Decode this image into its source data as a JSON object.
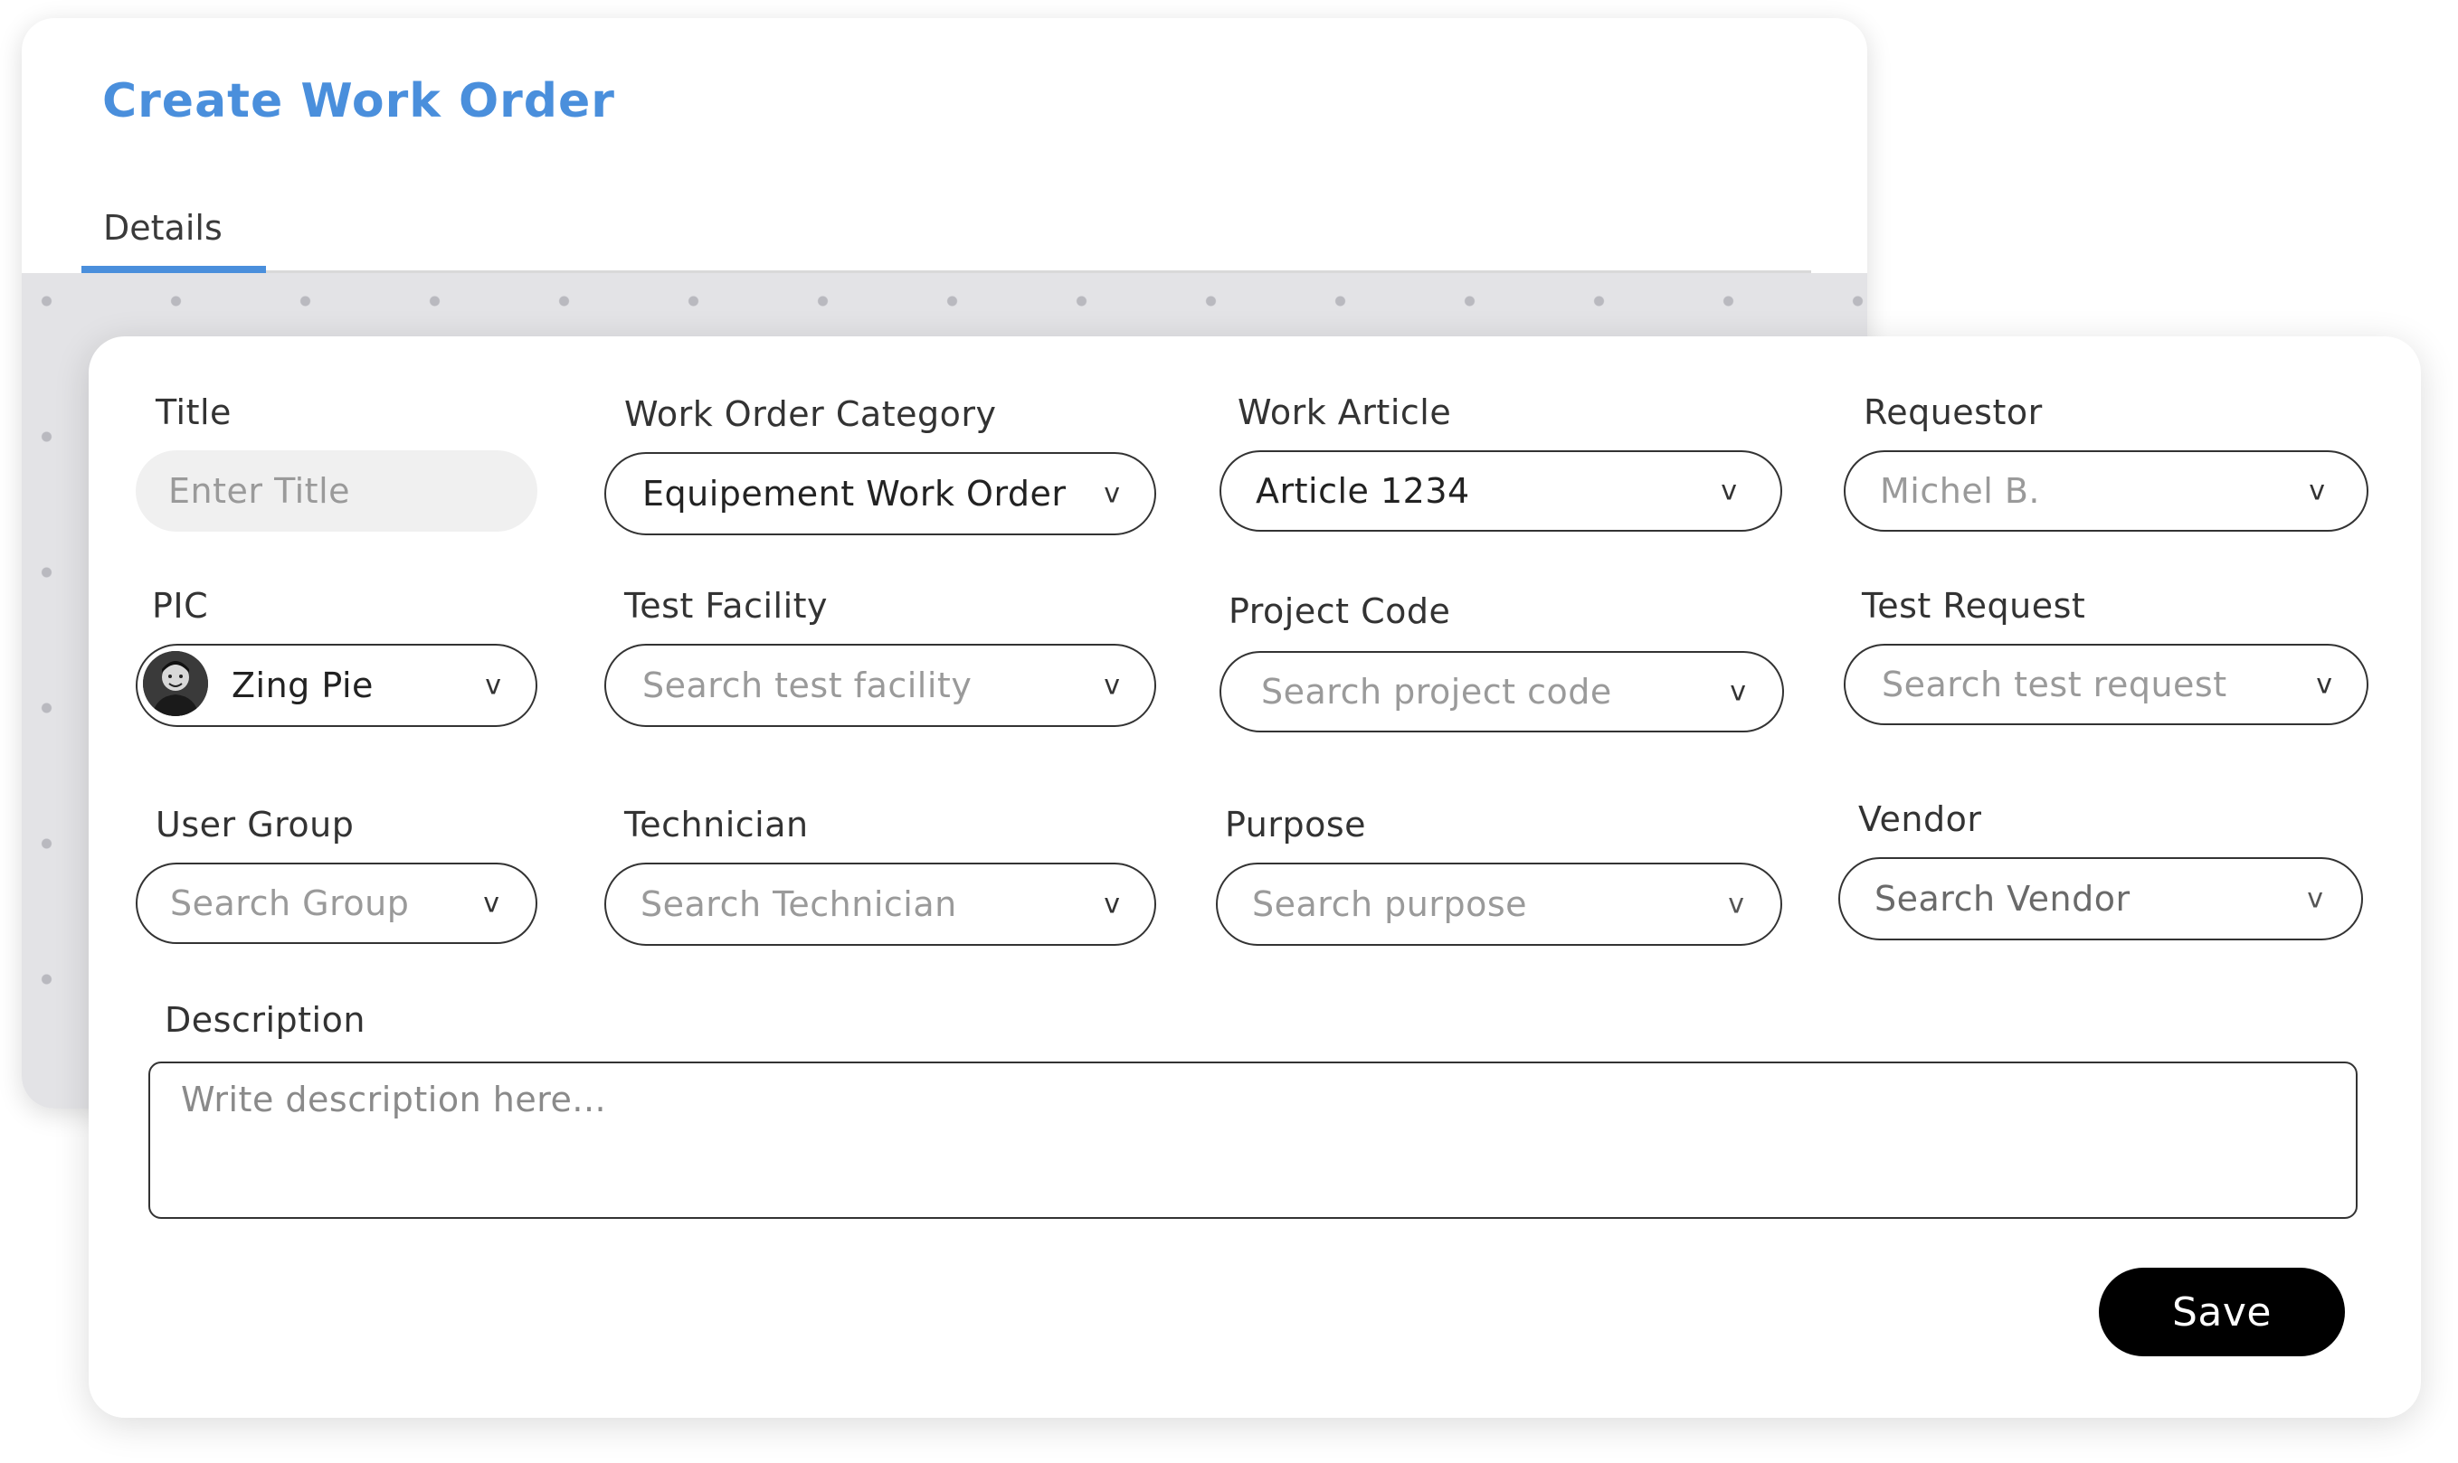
{
  "page": {
    "title": "Create Work Order",
    "tabs": [
      {
        "label": "Details",
        "active": true
      }
    ]
  },
  "form": {
    "title": {
      "label": "Title",
      "placeholder": "Enter Title"
    },
    "work_order_category": {
      "label": "Work Order Category",
      "value": "Equipement Work Order"
    },
    "work_article": {
      "label": "Work Article",
      "value": "Article 1234"
    },
    "requestor": {
      "label": "Requestor",
      "placeholder": "Michel B."
    },
    "pic": {
      "label": "PIC",
      "value": "Zing Pie"
    },
    "test_facility": {
      "label": "Test Facility",
      "placeholder": "Search test facility"
    },
    "project_code": {
      "label": "Project Code",
      "placeholder": "Search project code"
    },
    "test_request": {
      "label": "Test Request",
      "placeholder": "Search test request"
    },
    "user_group": {
      "label": "User Group",
      "placeholder": "Search Group"
    },
    "technician": {
      "label": "Technician",
      "placeholder": "Search Technician"
    },
    "purpose": {
      "label": "Purpose",
      "placeholder": "Search purpose"
    },
    "vendor": {
      "label": "Vendor",
      "placeholder": "Search Vendor"
    },
    "description": {
      "label": "Description",
      "placeholder": "Write description here..."
    },
    "save_label": "Save",
    "chevron": "v"
  },
  "icons": {
    "dropdown": "chevron-down-icon",
    "avatar": "user-avatar"
  },
  "colors": {
    "accent": "#4a8fdc",
    "button": "#000000",
    "border": "#333333",
    "placeholder": "#9a9a9a"
  }
}
